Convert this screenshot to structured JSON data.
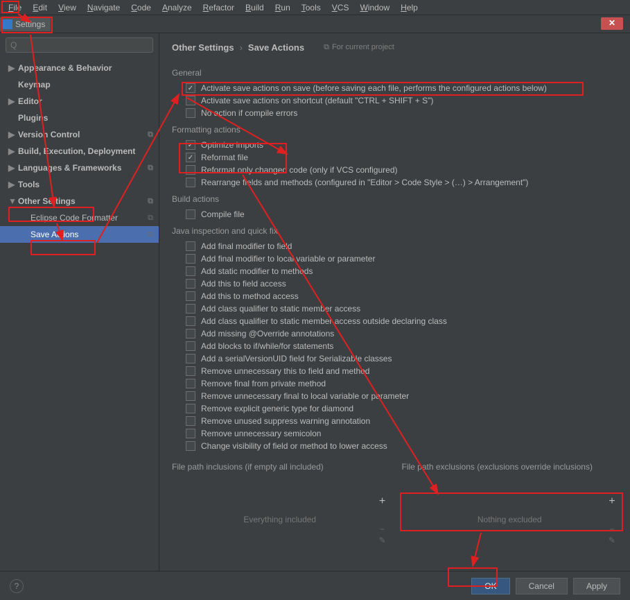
{
  "menu": [
    "File",
    "Edit",
    "View",
    "Navigate",
    "Code",
    "Analyze",
    "Refactor",
    "Build",
    "Run",
    "Tools",
    "VCS",
    "Window",
    "Help"
  ],
  "tab": {
    "label": "Settings"
  },
  "search": {
    "placeholder": "Q"
  },
  "tree": [
    {
      "label": "Appearance & Behavior",
      "arrow": "▶",
      "bold": true,
      "lvl": 0
    },
    {
      "label": "Keymap",
      "arrow": "",
      "bold": true,
      "lvl": 0
    },
    {
      "label": "Editor",
      "arrow": "▶",
      "bold": true,
      "lvl": 0
    },
    {
      "label": "Plugins",
      "arrow": "",
      "bold": true,
      "lvl": 0
    },
    {
      "label": "Version Control",
      "arrow": "▶",
      "bold": true,
      "lvl": 0,
      "cfg": true
    },
    {
      "label": "Build, Execution, Deployment",
      "arrow": "▶",
      "bold": true,
      "lvl": 0
    },
    {
      "label": "Languages & Frameworks",
      "arrow": "▶",
      "bold": true,
      "lvl": 0,
      "cfg": true
    },
    {
      "label": "Tools",
      "arrow": "▶",
      "bold": true,
      "lvl": 0
    },
    {
      "label": "Other Settings",
      "arrow": "▼",
      "bold": true,
      "lvl": 0,
      "cfg": true
    },
    {
      "label": "Eclipse Code Formatter",
      "arrow": "",
      "bold": false,
      "lvl": 1,
      "cfg": true
    },
    {
      "label": "Save Actions",
      "arrow": "",
      "bold": false,
      "lvl": 1,
      "selected": true,
      "cfg": true
    }
  ],
  "crumbs": {
    "a": "Other Settings",
    "b": "Save Actions",
    "badge": "For current project"
  },
  "sections": {
    "general": {
      "title": "General",
      "items": [
        {
          "checked": true,
          "label": "Activate save actions on save (before saving each file, performs the configured actions below)"
        },
        {
          "checked": false,
          "label": "Activate save actions on shortcut (default \"CTRL + SHIFT + S\")"
        },
        {
          "checked": false,
          "label": "No action if compile errors"
        }
      ]
    },
    "formatting": {
      "title": "Formatting actions",
      "items": [
        {
          "checked": true,
          "label": "Optimize imports"
        },
        {
          "checked": true,
          "label": "Reformat file"
        },
        {
          "checked": false,
          "label": "Reformat only changed code (only if VCS configured)"
        },
        {
          "checked": false,
          "label": "Rearrange fields and methods (configured in \"Editor > Code Style > (…) > Arrangement\")"
        }
      ]
    },
    "build": {
      "title": "Build actions",
      "items": [
        {
          "checked": false,
          "label": "Compile file"
        }
      ]
    },
    "java": {
      "title": "Java inspection and quick fix",
      "items": [
        {
          "checked": false,
          "label": "Add final modifier to field"
        },
        {
          "checked": false,
          "label": "Add final modifier to local variable or parameter"
        },
        {
          "checked": false,
          "label": "Add static modifier to methods"
        },
        {
          "checked": false,
          "label": "Add this to field access"
        },
        {
          "checked": false,
          "label": "Add this to method access"
        },
        {
          "checked": false,
          "label": "Add class qualifier to static member access"
        },
        {
          "checked": false,
          "label": "Add class qualifier to static member access outside declaring class"
        },
        {
          "checked": false,
          "label": "Add missing @Override annotations"
        },
        {
          "checked": false,
          "label": "Add blocks to if/while/for statements"
        },
        {
          "checked": false,
          "label": "Add a serialVersionUID field for Serializable classes"
        },
        {
          "checked": false,
          "label": "Remove unnecessary this to field and method"
        },
        {
          "checked": false,
          "label": "Remove final from private method"
        },
        {
          "checked": false,
          "label": "Remove unnecessary final to local variable or parameter"
        },
        {
          "checked": false,
          "label": "Remove explicit generic type for diamond"
        },
        {
          "checked": false,
          "label": "Remove unused suppress warning annotation"
        },
        {
          "checked": false,
          "label": "Remove unnecessary semicolon"
        },
        {
          "checked": false,
          "label": "Change visibility of field or method to lower access"
        }
      ]
    }
  },
  "inclusions": {
    "title": "File path inclusions (if empty all included)",
    "empty": "Everything included"
  },
  "exclusions": {
    "title": "File path exclusions (exclusions override inclusions)",
    "empty": "Nothing excluded"
  },
  "buttons": {
    "ok": "OK",
    "cancel": "Cancel",
    "apply": "Apply"
  }
}
